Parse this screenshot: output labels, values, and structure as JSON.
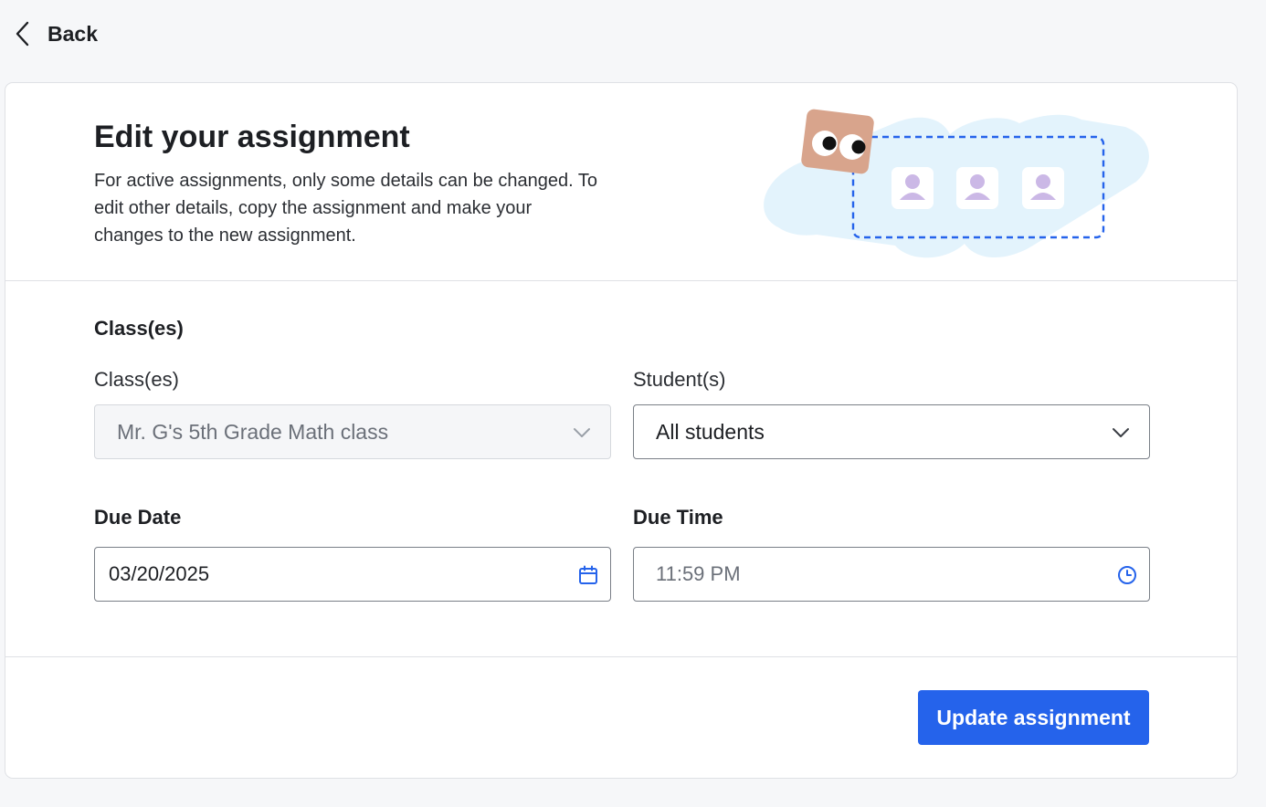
{
  "nav": {
    "back_label": "Back"
  },
  "header": {
    "title": "Edit your assignment",
    "description": "For active assignments, only some details can be changed. To edit other details, copy the assignment and make your changes to the new assignment."
  },
  "form": {
    "section_title": "Class(es)",
    "classes": {
      "label": "Class(es)",
      "value": "Mr. G's 5th Grade Math class",
      "disabled": true
    },
    "students": {
      "label": "Student(s)",
      "value": "All students"
    },
    "due_date": {
      "label": "Due Date",
      "value": "03/20/2025"
    },
    "due_time": {
      "label": "Due Time",
      "value": "11:59 PM"
    }
  },
  "actions": {
    "submit_label": "Update assignment"
  },
  "colors": {
    "accent": "#2563eb",
    "illustration_bg": "#e3f3fc",
    "avatar": "#cbb8e6",
    "character": "#d8a48c"
  }
}
